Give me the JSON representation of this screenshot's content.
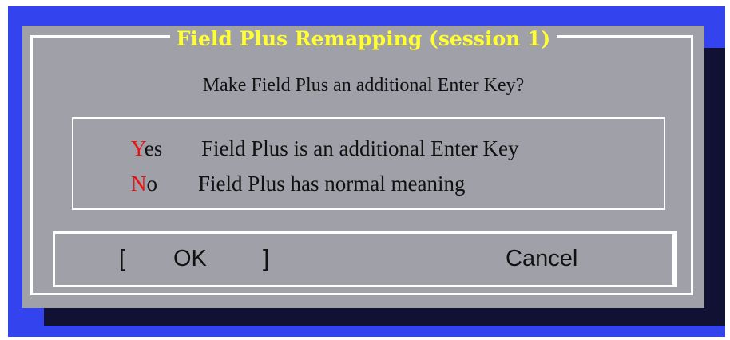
{
  "dialog": {
    "title": "Field Plus Remapping (session 1)",
    "question": "Make Field Plus an additional Enter Key?"
  },
  "options": [
    {
      "hotkey": "Y",
      "rest": "es",
      "description": "Field Plus is an additional Enter Key"
    },
    {
      "hotkey": "N",
      "rest": "o",
      "description": "Field Plus has normal meaning"
    }
  ],
  "buttons": {
    "ok": {
      "bracket_left": "[",
      "label": "OK",
      "bracket_right": "]"
    },
    "cancel": {
      "label": "Cancel"
    }
  },
  "colors": {
    "background": "#3344ee",
    "shadow": "#111133",
    "dialog": "#a0a0a8",
    "title": "#ffff33",
    "hotkey": "#ee1111",
    "frame": "#ffffff"
  }
}
